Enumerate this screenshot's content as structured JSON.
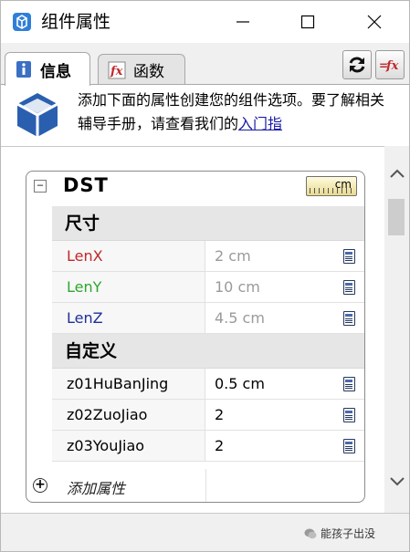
{
  "window": {
    "title": "组件属性"
  },
  "tabs": [
    {
      "label": "信息"
    },
    {
      "label": "函数"
    }
  ],
  "info": {
    "text": "添加下面的属性创建您的组件选项。要了解相关辅导手册，请查看我们的",
    "link": "入门指"
  },
  "component": {
    "name": "DST",
    "unit": "cm",
    "sections": [
      {
        "title": "尺寸",
        "rows": [
          {
            "name": "LenX",
            "value": "2 cm",
            "color": "#c0282d"
          },
          {
            "name": "LenY",
            "value": "10 cm",
            "color": "#2ea62e"
          },
          {
            "name": "LenZ",
            "value": "4.5 cm",
            "color": "#1f2f9a"
          }
        ]
      },
      {
        "title": "自定义",
        "rows": [
          {
            "name": "z01HuBanJing",
            "value": "0.5 cm"
          },
          {
            "name": "z02ZuoJiao",
            "value": "2"
          },
          {
            "name": "z03YouJiao",
            "value": "2"
          }
        ]
      }
    ],
    "add_label": "添加属性"
  },
  "watermark": "能孩子出没"
}
